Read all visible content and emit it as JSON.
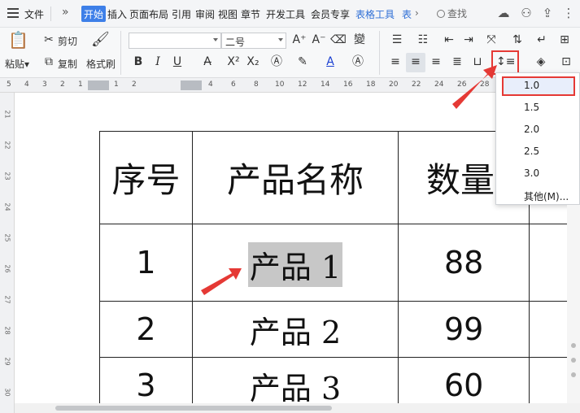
{
  "menubar": {
    "file": "文件",
    "tabs": [
      "开始",
      "插入",
      "页面布局",
      "引用",
      "审阅",
      "视图",
      "章节",
      "开发工具",
      "会员专享",
      "表格工具",
      "表"
    ],
    "search": "查找"
  },
  "ribbon": {
    "cut": "剪切",
    "paste": "粘贴",
    "copy": "复制",
    "format_painter": "格式刷",
    "font_size": "二号",
    "font_name": "",
    "bold": "B",
    "italic": "I",
    "underline": "U"
  },
  "ruler": {
    "numbers": [
      "5",
      "4",
      "3",
      "2",
      "1",
      "1",
      "2",
      "4",
      "6",
      "8",
      "10",
      "12",
      "14",
      "16",
      "18",
      "20",
      "22",
      "24",
      "26",
      "28"
    ],
    "vertical": [
      "21",
      "22",
      "23",
      "24",
      "25",
      "26",
      "27",
      "28",
      "29",
      "30"
    ]
  },
  "table": {
    "headers": [
      "序号",
      "产品名称",
      "数量"
    ],
    "rows": [
      {
        "no": "1",
        "name": "产品 1",
        "qty": "88"
      },
      {
        "no": "2",
        "name": "产品 2",
        "qty": "99"
      },
      {
        "no": "3",
        "name": "产品 3",
        "qty": "60"
      }
    ]
  },
  "line_spacing_menu": {
    "options": [
      "1.0",
      "1.5",
      "2.0",
      "2.5",
      "3.0",
      "其他(M)..."
    ],
    "selected": "1.0"
  },
  "colors": {
    "accent": "#3d7fe8",
    "annotation": "#e53935",
    "selection": "#c7c7c7"
  }
}
